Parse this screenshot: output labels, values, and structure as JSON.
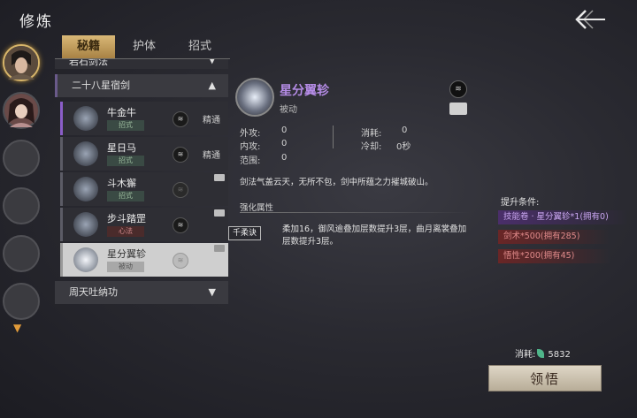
{
  "header": {
    "title": "修炼"
  },
  "tabs": [
    {
      "label": "秘籍"
    },
    {
      "label": "护体"
    },
    {
      "label": "招式"
    }
  ],
  "list": {
    "partial_group": "岩石剑法",
    "group_expanded": "二十八星宿剑",
    "group_collapsed": "周天吐纳功",
    "skills": [
      {
        "name": "牛金牛",
        "tag": "招式",
        "rank": "≋",
        "proficiency": "精通"
      },
      {
        "name": "星日马",
        "tag": "招式",
        "rank": "≋",
        "proficiency": "精通"
      },
      {
        "name": "斗木獬",
        "tag": "招式",
        "rank": "≋",
        "proficiency": ""
      },
      {
        "name": "步斗踏罡",
        "tag": "心法",
        "rank": "≋",
        "proficiency": ""
      },
      {
        "name": "星分翼轸",
        "tag": "被动",
        "rank": "≋",
        "proficiency": ""
      }
    ]
  },
  "detail": {
    "name": "星分翼轸",
    "type": "被动",
    "rank": "≋",
    "stats": {
      "wai_gong_label": "外攻:",
      "wai_gong": "0",
      "nei_gong_label": "内攻:",
      "nei_gong": "0",
      "fan_wei_label": "范围:",
      "fan_wei": "0",
      "xiao_hao_label": "消耗:",
      "xiao_hao": "0",
      "leng_que_label": "冷却:",
      "leng_que": "0秒"
    },
    "description": "剑法气盖云天，无所不包，剑中所蕴之力摧城破山。",
    "enhance_header": "强化属性",
    "enhance_tag": "千柔诀",
    "enhance_text": "柔加16，御风逾叠加层数提升3层，曲月离裳叠加层数提升3层。"
  },
  "requirements": {
    "title": "提升条件:",
    "items": [
      {
        "text": "技能卷 · 星分翼轸*1(拥有0)",
        "color": "purple"
      },
      {
        "text": "剑术*500(拥有285)",
        "color": "red"
      },
      {
        "text": "悟性*200(拥有45)",
        "color": "red"
      }
    ]
  },
  "cost": {
    "label": "消耗:",
    "value": "5832"
  },
  "action": {
    "label": "领悟"
  },
  "colors": {
    "accent_gold": "#d9b877",
    "skill_purple": "#b58ce6",
    "req_red": "#e08a8a"
  }
}
